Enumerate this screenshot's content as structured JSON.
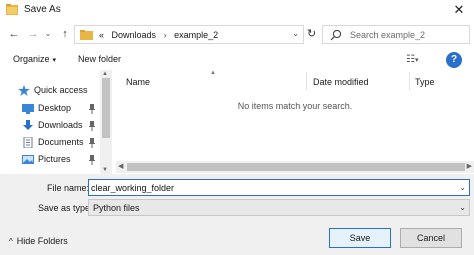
{
  "window": {
    "title": "Save As",
    "close_glyph": "✕"
  },
  "nav": {
    "back_glyph": "←",
    "forward_glyph": "→",
    "recent_glyph": "⌄",
    "up_glyph": "↑",
    "breadcrumb": {
      "prefix": "«",
      "items": [
        "Downloads",
        "example_2"
      ],
      "separator": "›"
    },
    "refresh_glyph": "↻",
    "search_placeholder": "Search example_2"
  },
  "toolbar": {
    "organize_label": "Organize",
    "new_folder_label": "New folder",
    "help_label": "?"
  },
  "sidebar": {
    "quick_access_label": "Quick access",
    "items": [
      {
        "label": "Desktop",
        "icon": "desktop-icon"
      },
      {
        "label": "Downloads",
        "icon": "download-icon"
      },
      {
        "label": "Documents",
        "icon": "documents-icon"
      },
      {
        "label": "Pictures",
        "icon": "pictures-icon"
      }
    ]
  },
  "files": {
    "columns": [
      "Name",
      "Date modified",
      "Type"
    ],
    "empty_message": "No items match your search."
  },
  "form": {
    "file_name_label": "File name:",
    "file_name_value": "clear_working_folder",
    "save_as_type_label": "Save as type:",
    "save_as_type_value": "Python files"
  },
  "footer": {
    "hide_folders_label": "Hide Folders",
    "save_label": "Save",
    "cancel_label": "Cancel"
  },
  "colors": {
    "accent": "#2a6fc9",
    "folder": "#e8b547",
    "bottom_panel": "#f0f0f0"
  }
}
